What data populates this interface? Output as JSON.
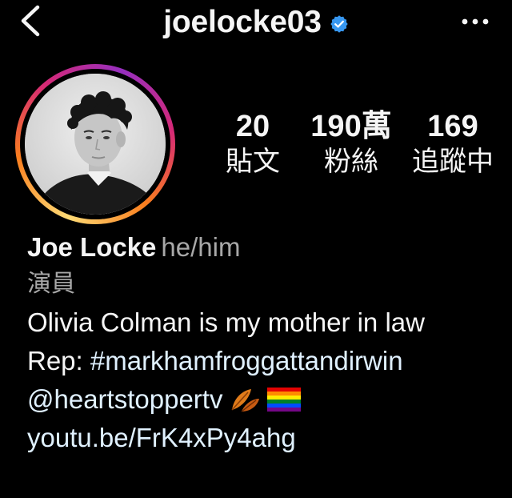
{
  "header": {
    "username": "joelocke03",
    "icons": {
      "back": "back-chevron-icon",
      "verified": "verified-badge-icon",
      "more": "more-options-icon"
    },
    "verified_color": "#3797f0"
  },
  "stats": {
    "posts": {
      "value": "20",
      "label": "貼文"
    },
    "followers": {
      "value": "190萬",
      "label": "粉絲"
    },
    "following": {
      "value": "169",
      "label": "追蹤中"
    }
  },
  "bio": {
    "name": "Joe Locke",
    "pronouns": "he/him",
    "category": "演員",
    "line1": "Olivia Colman is my mother in law",
    "rep_prefix": "Rep: ",
    "rep_hashtag": "#markhamfroggattandirwin",
    "mention": "@heartstoppertv",
    "emojis": [
      "fallen-leaves-emoji",
      "rainbow-flag-emoji"
    ],
    "link": "youtu.be/FrK4xPy4ahg"
  },
  "colors": {
    "background": "#000000",
    "text": "#f5f5f5",
    "secondary_text": "#a8a8a8",
    "link": "#e0f1ff",
    "story_ring": [
      "#feda75",
      "#fa7e1e",
      "#d62976",
      "#962fbf"
    ]
  }
}
